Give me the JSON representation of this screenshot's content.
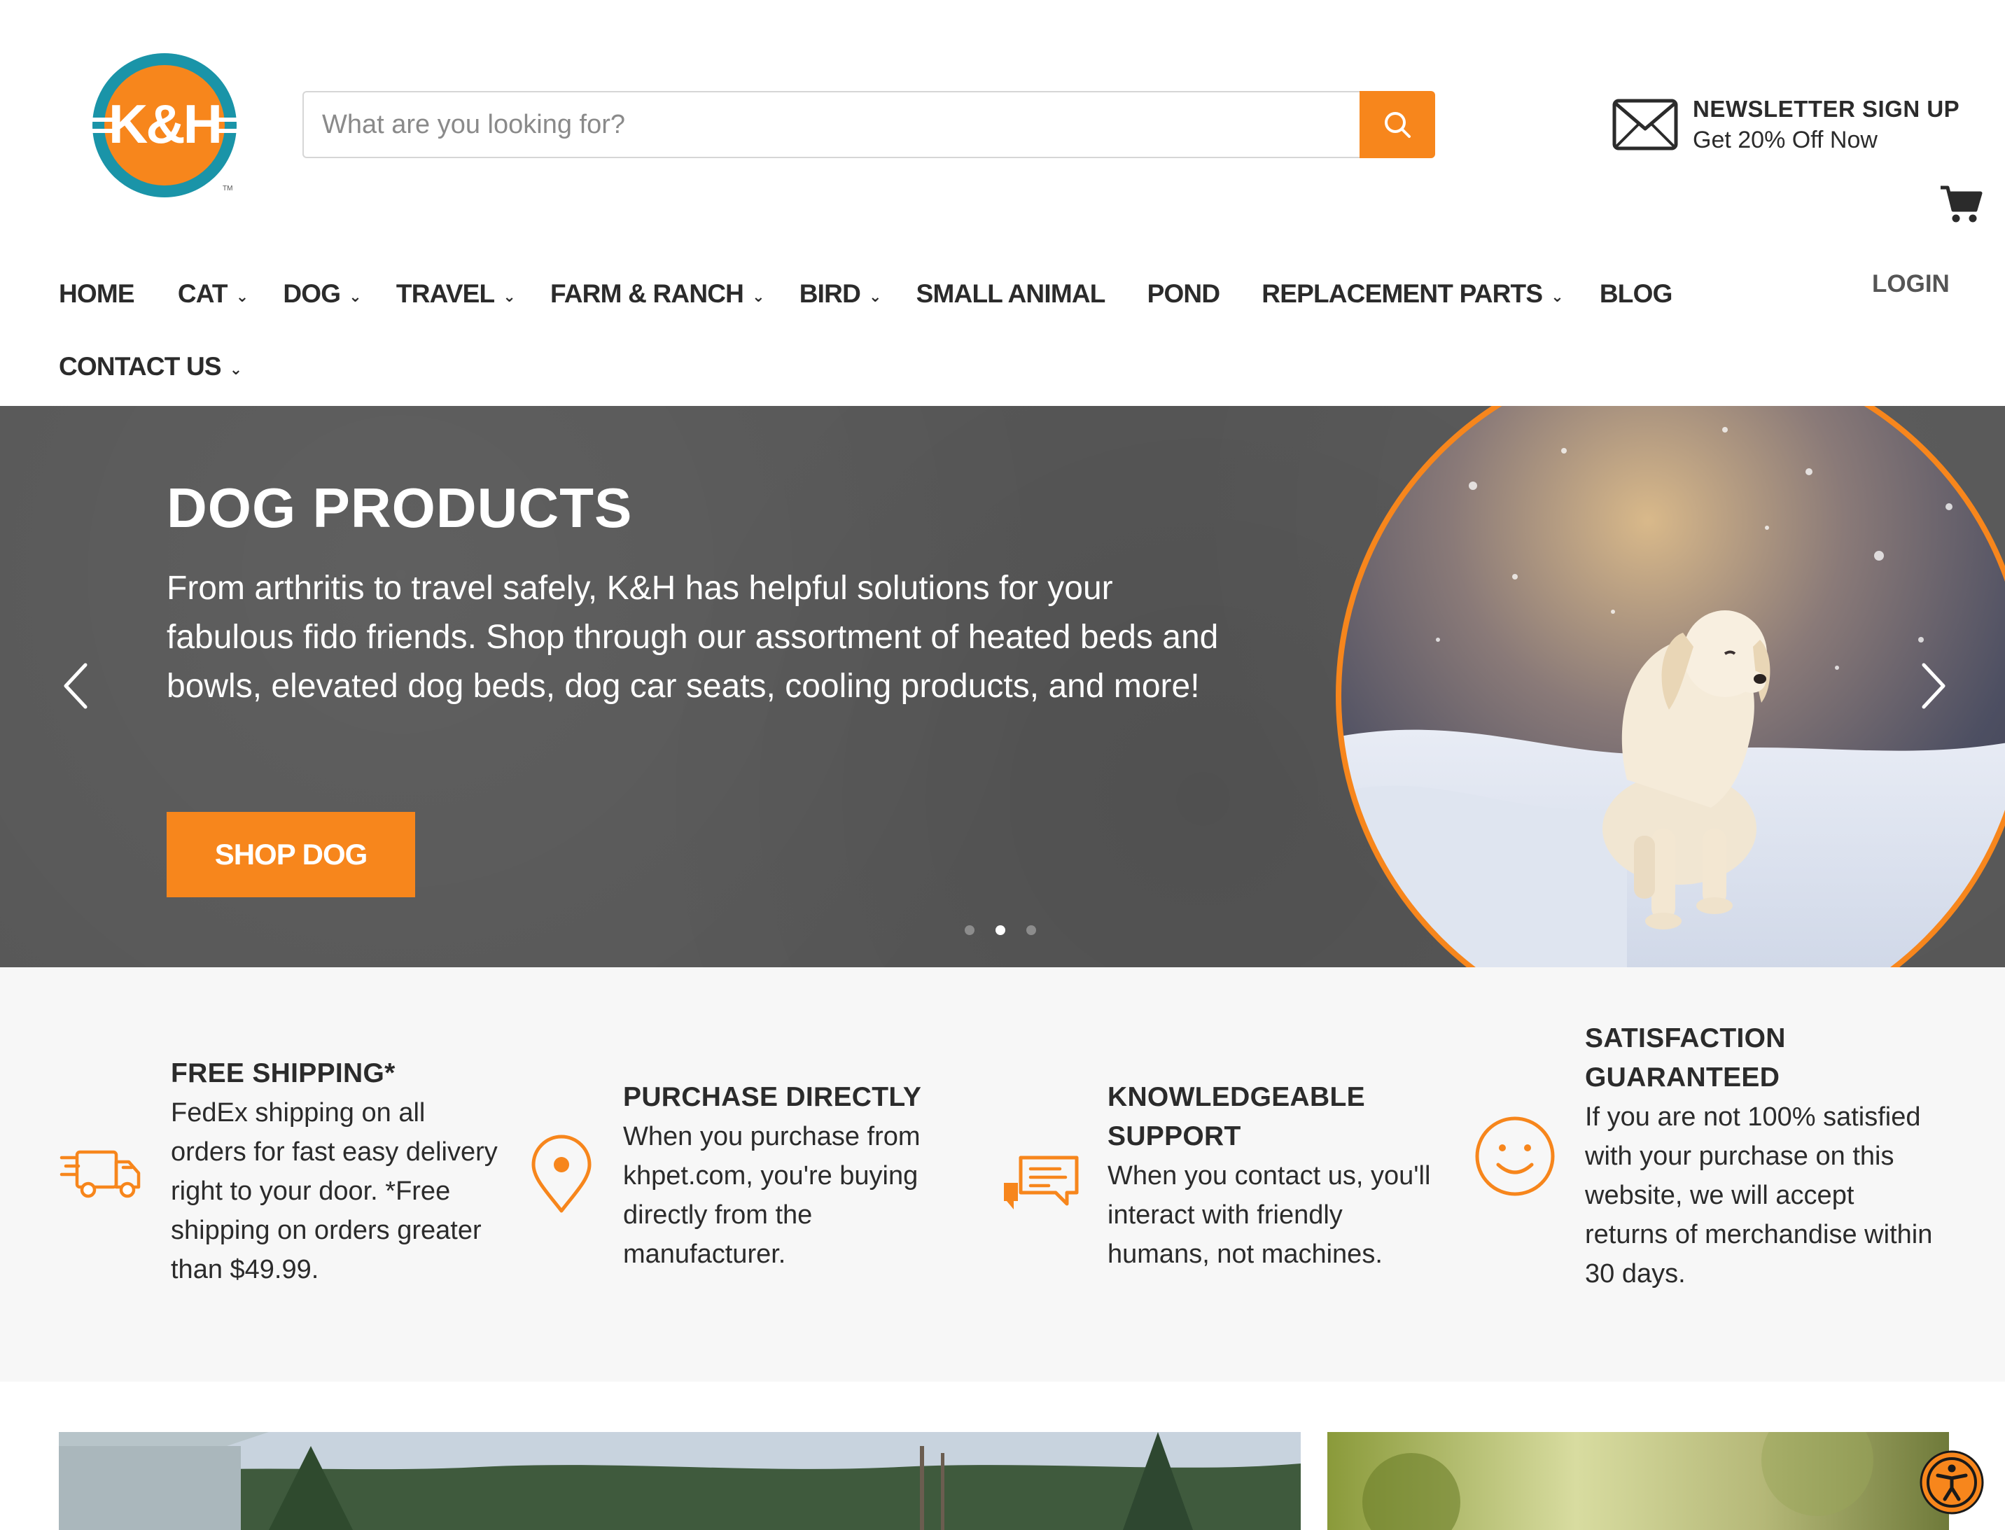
{
  "brand": {
    "logo_text": "K&H",
    "trademark": "TM",
    "accent_color": "#f7861c",
    "ring_color": "#1a94a8"
  },
  "search": {
    "placeholder": "What are you looking for?",
    "value": ""
  },
  "newsletter": {
    "title": "NEWSLETTER SIGN UP",
    "subtitle": "Get 20% Off Now"
  },
  "nav": {
    "items": [
      {
        "label": "HOME",
        "has_dropdown": false
      },
      {
        "label": "CAT",
        "has_dropdown": true
      },
      {
        "label": "DOG",
        "has_dropdown": true
      },
      {
        "label": "TRAVEL",
        "has_dropdown": true
      },
      {
        "label": "FARM & RANCH",
        "has_dropdown": true
      },
      {
        "label": "BIRD",
        "has_dropdown": true
      },
      {
        "label": "SMALL ANIMAL",
        "has_dropdown": false
      },
      {
        "label": "POND",
        "has_dropdown": false
      },
      {
        "label": "REPLACEMENT PARTS",
        "has_dropdown": true
      },
      {
        "label": "BLOG",
        "has_dropdown": false
      },
      {
        "label": "CONTACT US",
        "has_dropdown": true
      }
    ],
    "login": "LOGIN",
    "chevron": "⌄"
  },
  "hero": {
    "title": "DOG PRODUCTS",
    "text": "From arthritis to travel safely, K&H has helpful solutions for your fabulous fido friends. Shop through our assortment of heated beds and bowls, elevated dog beds, dog car seats, cooling products, and more!",
    "cta": "SHOP DOG",
    "slide_count": 3,
    "active_slide": 2
  },
  "features": [
    {
      "icon": "truck-icon",
      "title": "FREE SHIPPING*",
      "body": "FedEx shipping on all orders for fast easy delivery right to your door. *Free shipping on orders greater than $49.99."
    },
    {
      "icon": "map-pin-icon",
      "title": "PURCHASE DIRECTLY",
      "body": "When you purchase from khpet.com, you're buying directly from the manufacturer."
    },
    {
      "icon": "chat-bubbles-icon",
      "title": "KNOWLEDGEABLE SUPPORT",
      "body": "When you contact us, you'll interact with friendly humans, not machines."
    },
    {
      "icon": "smiley-icon",
      "title": "SATISFACTION GUARANTEED",
      "body": "If you are not 100% satisfied with your purchase on this website, we will accept returns of merchandise within 30 days."
    }
  ]
}
